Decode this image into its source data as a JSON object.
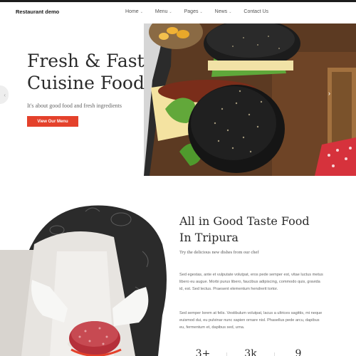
{
  "header": {
    "logo": "Restaurant demo",
    "nav": [
      {
        "label": "Home",
        "has_dropdown": true
      },
      {
        "label": "Menu",
        "has_dropdown": true
      },
      {
        "label": "Pages",
        "has_dropdown": true
      },
      {
        "label": "News",
        "has_dropdown": true
      },
      {
        "label": "Contact Us",
        "has_dropdown": false
      }
    ],
    "dropdown_icon": "chevron-down-icon"
  },
  "hero": {
    "title_line1": "Fresh & Fast",
    "title_line2": "Cuisine Food",
    "subtitle": "It's about good food and fresh ingredients",
    "button_label": "View Our Menu",
    "button_color": "#e4412b",
    "prev_icon": "chevron-left-icon",
    "next_icon": "chevron-right-icon",
    "prev_glyph": "‹",
    "next_glyph": "›"
  },
  "about": {
    "title_line1": "All in Good Taste Food",
    "title_line2": "In Tripura",
    "tagline": "Try the delicious new dishes from our chef",
    "paragraph1": "Sed egestas, ante et vulputate volutpat, eros pede semper est, vitae luctus metus libero eu augue. Morbi purus libero, faucibus adipiscing, commodo quis, gravida id, est. Sed lectus. Praesent elementum hendrerit tortor.",
    "paragraph2": "Sed semper lorem at felis. Vestibulum volutpat, lacus a ultrices sagittis, mi neque euismod dui, eu pulvinar nunc sapien ornare nisl. Phasellus pede arcu, dapibus eu, fermentum et, dapibus sed, urna.",
    "stats": [
      "3+",
      "3k",
      "9"
    ]
  }
}
